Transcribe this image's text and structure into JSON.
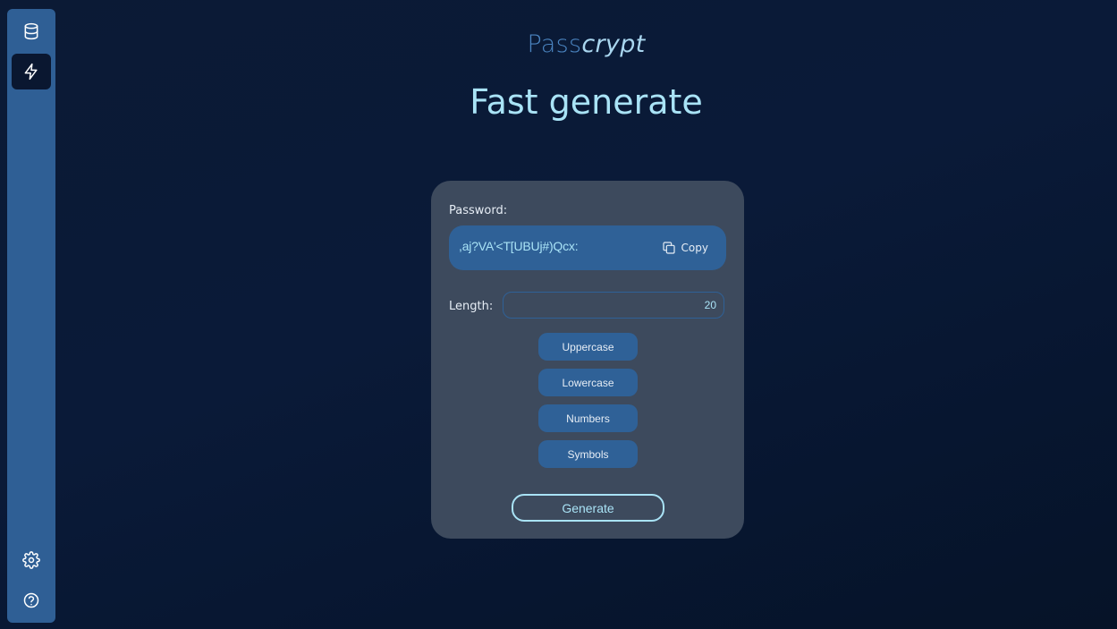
{
  "sidebar": {
    "items": [
      {
        "icon": "database-icon",
        "active": false
      },
      {
        "icon": "lightning-icon",
        "active": true
      }
    ],
    "bottom_items": [
      {
        "icon": "gear-icon"
      },
      {
        "icon": "help-icon"
      }
    ]
  },
  "brand": {
    "part1": "Pass",
    "part2": "crypt"
  },
  "page": {
    "title": "Fast generate"
  },
  "password": {
    "label": "Password:",
    "value": ",aj?VA'<T[UBUj#)Qcx:",
    "copy_label": "Copy"
  },
  "length": {
    "label": "Length:",
    "value": "20"
  },
  "options": {
    "uppercase": "Uppercase",
    "lowercase": "Lowercase",
    "numbers": "Numbers",
    "symbols": "Symbols"
  },
  "actions": {
    "generate": "Generate"
  },
  "colors": {
    "accent": "#a9e3f6",
    "button": "#2f6197",
    "card": "#3d4a5d",
    "sidebar": "#2f5f95"
  }
}
